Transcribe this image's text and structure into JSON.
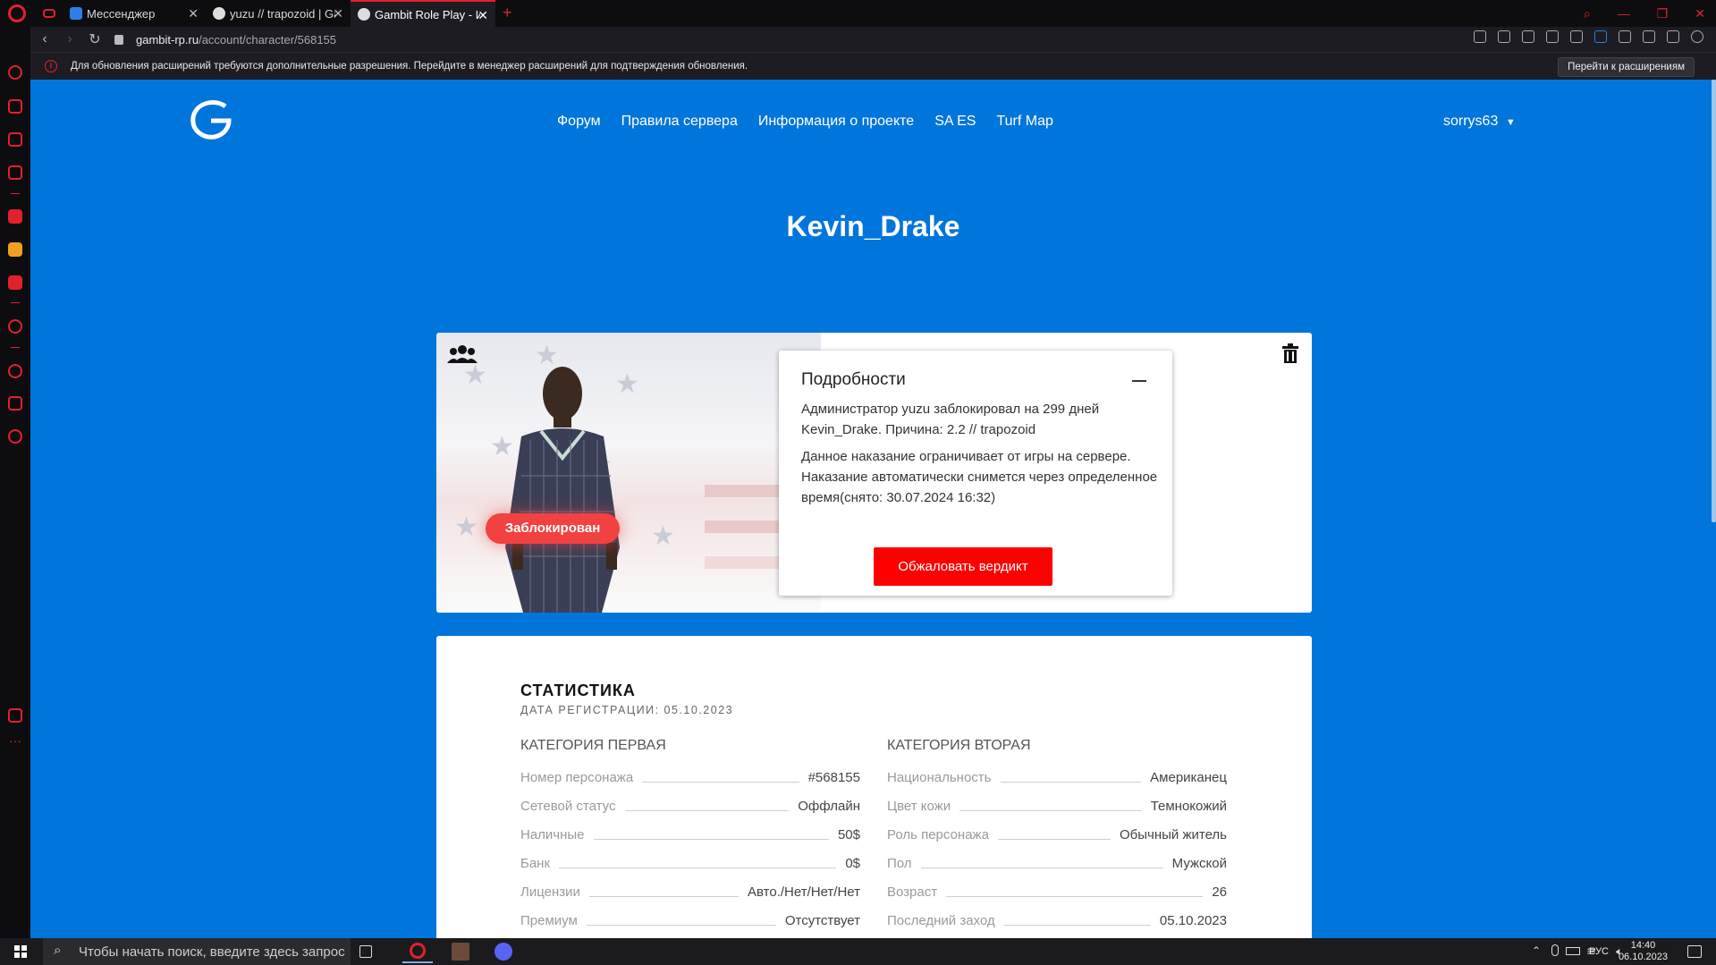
{
  "browser": {
    "tabs": [
      {
        "title": "Мессенджер",
        "active": false
      },
      {
        "title": "yuzu // trapozoid | Gambit",
        "active": false
      },
      {
        "title": "Gambit Role Play - Игровой",
        "active": true
      }
    ],
    "new_tab_label": "+",
    "url_host": "gambit-rp.ru",
    "url_path": "/account/character/568155",
    "notification_text": "Для обновления расширений требуются дополнительные разрешения. Перейдите в менеджер расширений для подтверждения обновления.",
    "notification_button": "Перейти к расширениям"
  },
  "site": {
    "nav": [
      "Форум",
      "Правила сервера",
      "Информация о проекте",
      "SA ES",
      "Turf Map"
    ],
    "username": "sorrys63",
    "character_name": "Kevin_Drake",
    "status_badge": "Заблокирован",
    "details": {
      "title": "Подробности",
      "text1": "Администратор yuzu заблокировал на 299 дней Kevin_Drake. Причина: 2.2 // trapozoid",
      "text2": "Данное наказание ограничивает от игры на сервере. Наказание автоматически снимется через определенное время(снято: 30.07.2024 16:32)",
      "appeal_button": "Обжаловать вердикт"
    },
    "stats": {
      "title": "СТАТИСТИКА",
      "registration": "ДАТА РЕГИСТРАЦИИ: 05.10.2023",
      "cat1_title": "КАТЕГОРИЯ ПЕРВАЯ",
      "cat2_title": "КАТЕГОРИЯ ВТОРАЯ",
      "cat1": [
        {
          "label": "Номер персонажа",
          "value": "#568155"
        },
        {
          "label": "Сетевой статус",
          "value": "Оффлайн"
        },
        {
          "label": "Наличные",
          "value": "50$"
        },
        {
          "label": "Банк",
          "value": "0$"
        },
        {
          "label": "Лицензии",
          "value": "Авто./Нет/Нет/Нет"
        },
        {
          "label": "Премиум",
          "value": "Отсутствует"
        }
      ],
      "cat2": [
        {
          "label": "Национальность",
          "value": "Американец"
        },
        {
          "label": "Цвет кожи",
          "value": "Темнокожий"
        },
        {
          "label": "Роль персонажа",
          "value": "Обычный житель"
        },
        {
          "label": "Пол",
          "value": "Мужской"
        },
        {
          "label": "Возраст",
          "value": "26"
        },
        {
          "label": "Последний заход",
          "value": "05.10.2023"
        }
      ]
    }
  },
  "taskbar": {
    "search_placeholder": "Чтобы начать поиск, введите здесь запрос",
    "lang": "РУС",
    "time": "14:40",
    "date": "06.10.2023"
  },
  "colors": {
    "page_bg": "#0075db",
    "opera_red": "#e1222d",
    "banned": "#f24141",
    "appeal": "#ff0000"
  }
}
